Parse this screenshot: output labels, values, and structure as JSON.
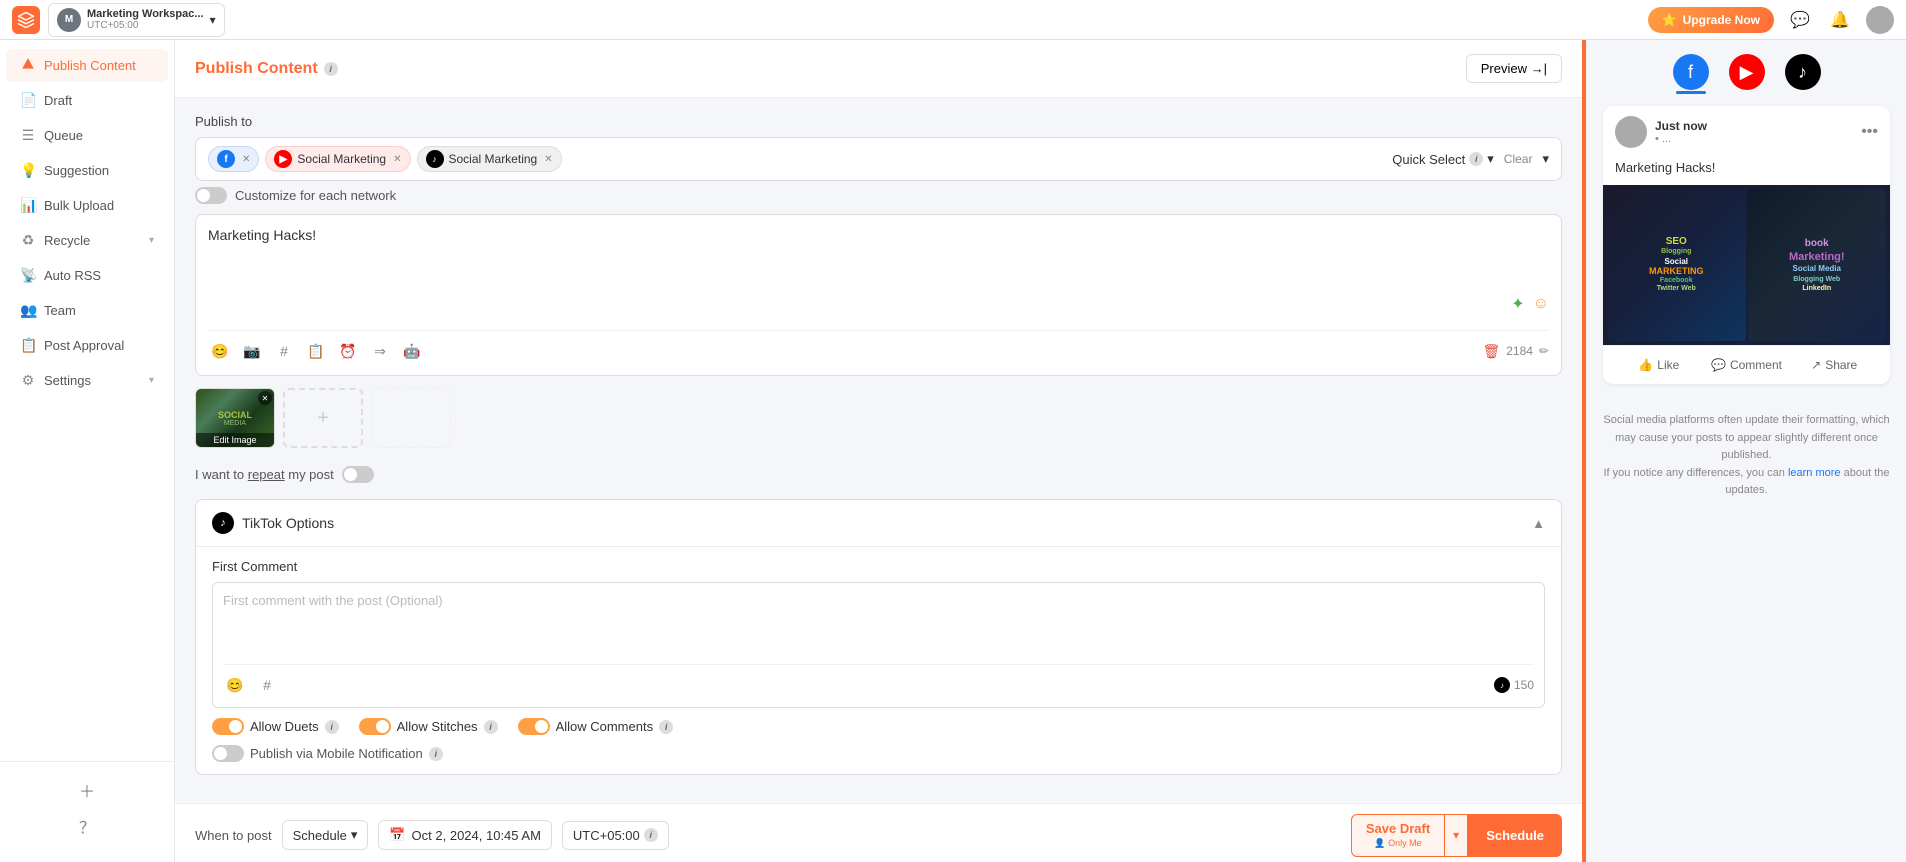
{
  "topbar": {
    "workspace_initial": "M",
    "workspace_name": "Marketing Workspac...",
    "workspace_tz": "UTC+05:00",
    "chevron": "▾",
    "upgrade_label": "Upgrade Now",
    "upgrade_icon": "⭐"
  },
  "sidebar": {
    "items": [
      {
        "id": "publish",
        "label": "Publish Content",
        "icon": "📤",
        "active": true
      },
      {
        "id": "draft",
        "label": "Draft",
        "icon": "📄",
        "active": false
      },
      {
        "id": "queue",
        "label": "Queue",
        "icon": "☰",
        "active": false
      },
      {
        "id": "suggestion",
        "label": "Suggestion",
        "icon": "👤",
        "active": false
      },
      {
        "id": "bulk",
        "label": "Bulk Upload",
        "icon": "📁",
        "active": false
      },
      {
        "id": "recycle",
        "label": "Recycle",
        "icon": "♻",
        "active": false,
        "expandable": true
      },
      {
        "id": "rss",
        "label": "Auto RSS",
        "icon": "📡",
        "active": false
      },
      {
        "id": "team",
        "label": "Team",
        "icon": "👥",
        "active": false
      },
      {
        "id": "approval",
        "label": "Post Approval",
        "icon": "📋",
        "active": false
      },
      {
        "id": "settings",
        "label": "Settings",
        "icon": "⚙",
        "active": false,
        "expandable": true
      }
    ],
    "bottom_icons": [
      "+",
      "?"
    ]
  },
  "editor": {
    "title": "Publish Content",
    "title_info": "?",
    "preview_btn": "Preview →|",
    "publish_to_label": "Publish to",
    "chips": [
      {
        "id": "fb",
        "label": "",
        "type": "fb"
      },
      {
        "id": "yt",
        "label": "Social Marketing",
        "type": "yt"
      },
      {
        "id": "tk",
        "label": "Social Marketing",
        "type": "tk"
      }
    ],
    "quick_select": "Quick Select",
    "clear": "Clear",
    "customize_label": "Customize for each network",
    "post_text": "Marketing Hacks!",
    "post_placeholder": "",
    "char_count": "2184",
    "repeat_label": "I want to repeat my post",
    "toolbar_icons": [
      "😊",
      "📷",
      "#",
      "📋",
      "⏰",
      "→▶",
      "🤖"
    ],
    "tiktok": {
      "title": "TikTok Options",
      "first_comment_label": "First Comment",
      "first_comment_placeholder": "First comment with the post (Optional)",
      "comment_char_count": "150",
      "allow_duets": "Allow Duets",
      "allow_stitches": "Allow Stitches",
      "allow_comments": "Allow Comments",
      "mobile_notify": "Publish via Mobile Notification",
      "duets_on": true,
      "stitches_on": true,
      "comments_on": true,
      "mobile_on": false
    },
    "schedule": {
      "when_label": "When to post",
      "type": "Schedule",
      "date": "Oct 2, 2024, 10:45 AM",
      "tz": "UTC+05:00",
      "tz_info": "?"
    },
    "save_draft": "Save Draft",
    "save_draft_sub": "Only Me",
    "schedule_btn": "Schedule"
  },
  "preview": {
    "platforms": [
      "fb",
      "yt",
      "tk"
    ],
    "active_platform": "fb",
    "card": {
      "user": "Just now",
      "time": "• ...",
      "post_text": "Marketing Hacks!",
      "action_like": "Like",
      "action_comment": "Comment",
      "action_share": "Share"
    },
    "note": "Social media platforms often update their formatting, which may cause your posts to appear slightly different once published.",
    "note_link": "learn more",
    "note_end": "about the updates."
  }
}
